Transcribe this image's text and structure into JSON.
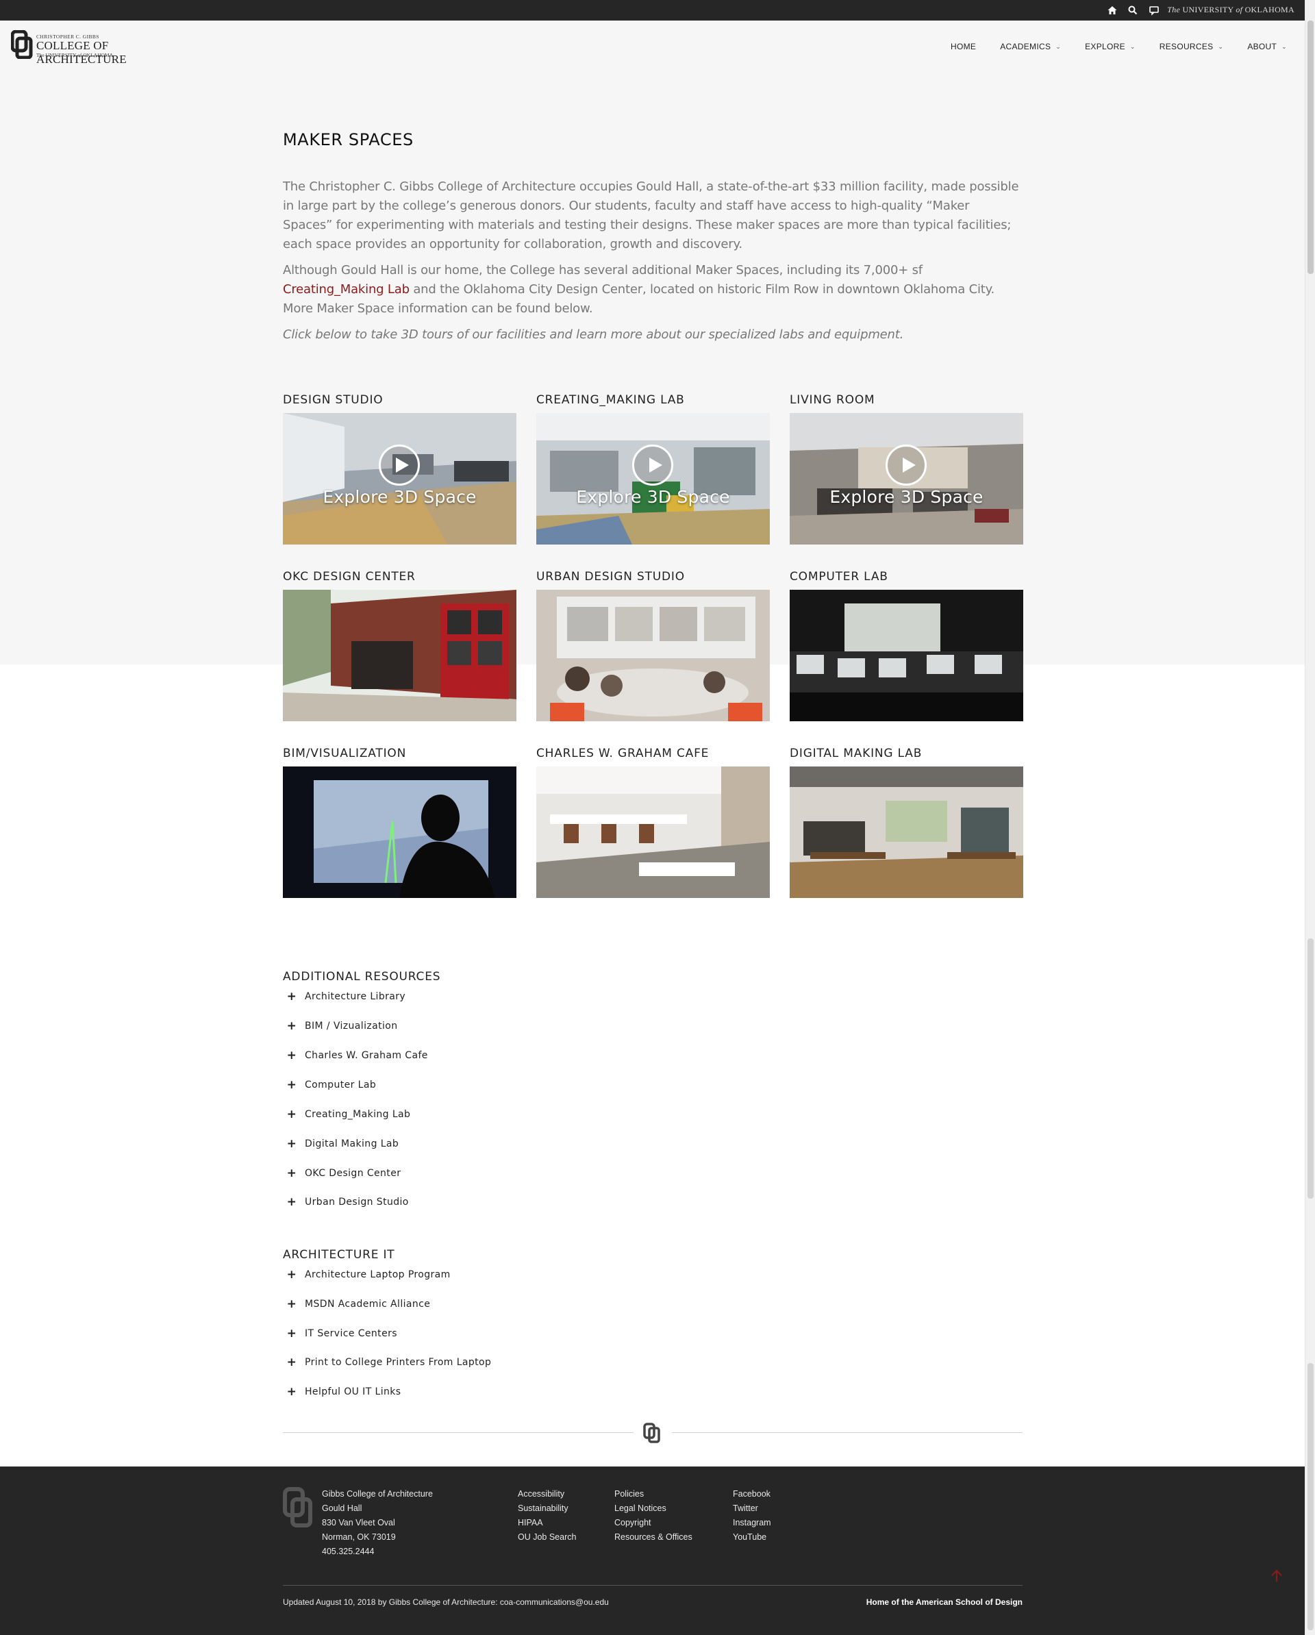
{
  "topbar": {
    "university_prefix": "The",
    "university_name": "UNIVERSITY",
    "university_of": "of",
    "university_state": "OKLAHOMA"
  },
  "header": {
    "logo": {
      "line1": "CHRISTOPHER C. GIBBS",
      "line2": "COLLEGE OF ARCHITECTURE",
      "line3": "The UNIVERSITY of OKLAHOMA"
    },
    "nav": [
      {
        "label": "HOME",
        "has_menu": false
      },
      {
        "label": "ACADEMICS",
        "has_menu": true
      },
      {
        "label": "EXPLORE",
        "has_menu": true
      },
      {
        "label": "RESOURCES",
        "has_menu": true
      },
      {
        "label": "ABOUT",
        "has_menu": true
      }
    ]
  },
  "main": {
    "title": "MAKER SPACES",
    "intro_1": "The Christopher C. Gibbs College of Architecture occupies Gould Hall, a state-of-the-art $33 million facility, made possible in large part by the college’s generous donors. Our students, faculty and staff have access to high-quality “Maker Spaces” for experimenting with materials and testing their designs. These maker spaces are more than typical facilities; each space provides an opportunity for collaboration, growth and discovery.",
    "intro_2_before": "Although Gould Hall is our home, the College has several additional Maker Spaces, including its 7,000+ sf ",
    "intro_2_link": "Creating_Making Lab",
    "intro_2_after": " and the Oklahoma City Design Center, located on historic Film Row in downtown Oklahoma City. More Maker Space information can be found below.",
    "intro_3": "Click below to take 3D tours of our facilities and learn more about our specialized labs and equipment.",
    "explore_label": "Explore 3D Space",
    "cards": [
      {
        "title": "DESIGN STUDIO"
      },
      {
        "title": "CREATING_MAKING LAB"
      },
      {
        "title": "LIVING ROOM"
      },
      {
        "title": "OKC DESIGN CENTER"
      },
      {
        "title": "URBAN DESIGN STUDIO"
      },
      {
        "title": "COMPUTER LAB"
      },
      {
        "title": "BIM/VISUALIZATION"
      },
      {
        "title": "CHARLES W. GRAHAM CAFE"
      },
      {
        "title": "DIGITAL MAKING LAB"
      }
    ]
  },
  "additional_resources": {
    "title": "ADDITIONAL RESOURCES",
    "items": [
      "Architecture Library",
      "BIM / Vizualization",
      "Charles W. Graham Cafe",
      "Computer Lab",
      "Creating_Making Lab",
      "Digital Making Lab",
      "OKC Design Center",
      "Urban Design Studio"
    ]
  },
  "architecture_it": {
    "title": "ARCHITECTURE IT",
    "items": [
      "Architecture Laptop Program",
      "MSDN Academic Alliance",
      "IT Service Centers",
      "Print to College Printers From Laptop",
      "Helpful OU IT Links"
    ]
  },
  "footer": {
    "address": [
      "Gibbs College of Architecture",
      "Gould Hall",
      "830 Van Vleet Oval",
      "Norman, OK 73019",
      "405.325.2444"
    ],
    "links_col1": [
      "Accessibility",
      "Sustainability",
      "HIPAA",
      "OU Job Search"
    ],
    "links_col2": [
      "Policies",
      "Legal Notices",
      "Copyright",
      "Resources & Offices"
    ],
    "social": [
      "Facebook",
      "Twitter",
      "Instagram",
      "YouTube"
    ],
    "updated": "Updated August 10, 2018 by Gibbs College of Architecture: coa-communications@ou.edu",
    "tagline": "Home of the American School of Design"
  },
  "colors": {
    "topbar_bg": "#262626",
    "footer_bg": "#262626",
    "link_crimson": "#8b1a1a",
    "page_gray": "#f6f6f6"
  }
}
